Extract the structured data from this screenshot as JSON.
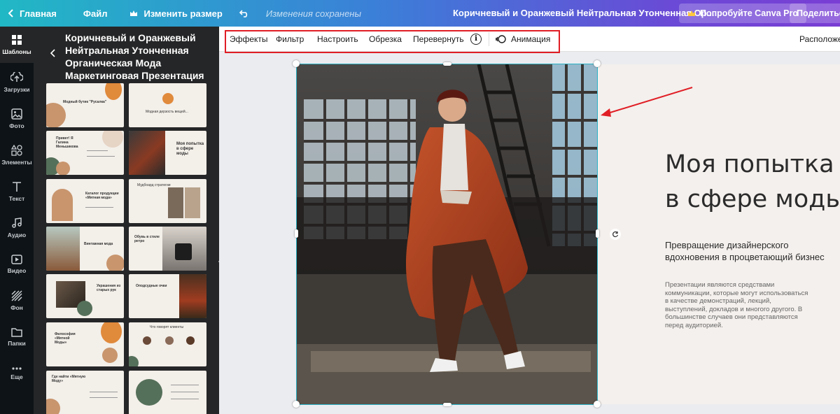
{
  "topbar": {
    "home": "Главная",
    "file": "Файл",
    "resize": "Изменить размер",
    "status": "Изменения сохранены",
    "title": "Коричневый и Оранжевый Нейтральная Утонченная Ор...",
    "try_pro": "Попробуйте Canva Pro",
    "share": "Поделиться"
  },
  "rail": [
    {
      "label": "Шаблоны",
      "icon": "templates-icon"
    },
    {
      "label": "Загрузки",
      "icon": "upload-icon"
    },
    {
      "label": "Фото",
      "icon": "photo-icon"
    },
    {
      "label": "Элементы",
      "icon": "elements-icon"
    },
    {
      "label": "Текст",
      "icon": "text-icon"
    },
    {
      "label": "Аудио",
      "icon": "audio-icon"
    },
    {
      "label": "Видео",
      "icon": "video-icon"
    },
    {
      "label": "Фон",
      "icon": "background-icon"
    },
    {
      "label": "Папки",
      "icon": "folder-icon"
    },
    {
      "label": "Еще",
      "icon": "more-icon"
    }
  ],
  "panel": {
    "title": "Коричневый и Оранжевый Нейтральная Утонченная Органическая Мода Маркетинговая Презентация",
    "thumbs": [
      {
        "text": "Модный бутик \"Русалка\""
      },
      {
        "text": "Модная дерзость вещей..."
      },
      {
        "text": "Привет! Я Галина Меньшикова"
      },
      {
        "text": "Моя попытка в сфере моды"
      },
      {
        "text": "Каталог продукции «Мятная мода»"
      },
      {
        "text": "Мудбоард стратегии"
      },
      {
        "text": "Винтажная мода"
      },
      {
        "text": "Обувь в стиле ретро"
      },
      {
        "text": "Украшения из старых рук"
      },
      {
        "text": "Оподсудные очки"
      },
      {
        "text": "Философия «Мятной Моды»"
      },
      {
        "text": "Что говорят клиенты"
      },
      {
        "text": "Где найти «Мятную Моду»"
      },
      {
        "text": ""
      }
    ]
  },
  "toolbar": {
    "effects": "Эффекты",
    "filter": "Фильтр",
    "adjust": "Настроить",
    "crop": "Обрезка",
    "flip": "Перевернуть",
    "info": "i",
    "animation": "Анимация",
    "position": "Расположение"
  },
  "slide": {
    "heading_line1": "Моя попытка",
    "heading_line2": "в сфере моды",
    "subheading": "Превращение дизайнерского вдохновения в процветающий бизнес",
    "body": "Презентации являются средствами коммуникации, которые могут использоваться в качестве демонстраций, лекций, выступлений, докладов и многого другого. В большинстве случаев они представляются перед аудиторией."
  },
  "colors": {
    "selection": "#2ab1c4",
    "highlight": "#e01e25",
    "rail_bg": "#0e1318",
    "panel_bg": "#252627"
  }
}
